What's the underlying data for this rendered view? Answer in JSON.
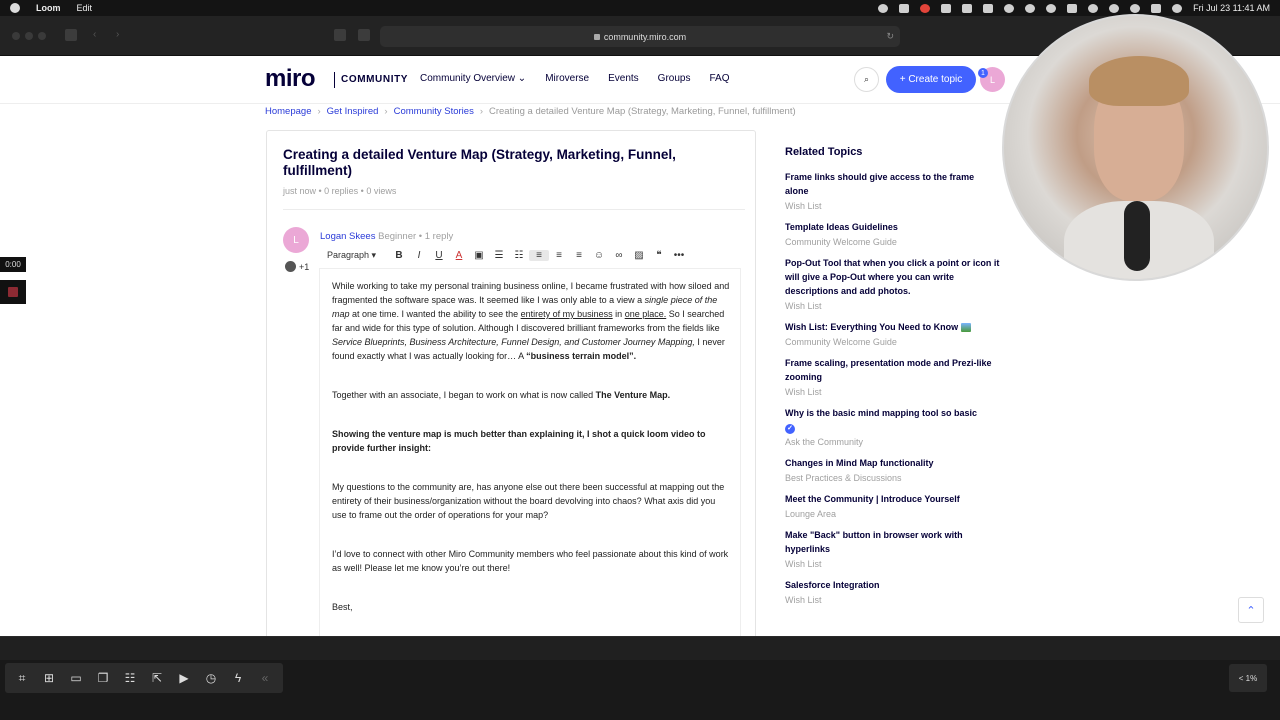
{
  "menubar": {
    "app_name": "Loom",
    "menu_edit": "Edit",
    "datetime": "Fri Jul 23  11:41 AM"
  },
  "browser": {
    "url": "community.miro.com"
  },
  "header": {
    "logo": "miro",
    "logo_suffix": "COMMUNITY",
    "nav": [
      "Community Overview ⌄",
      "Miroverse",
      "Events",
      "Groups",
      "FAQ"
    ],
    "create_topic": "+ Create topic",
    "avatar_initial": "L",
    "notification_count": "1"
  },
  "breadcrumb": {
    "items": [
      "Homepage",
      "Get Inspired",
      "Community Stories"
    ],
    "current": "Creating a detailed Venture Map (Strategy, Marketing, Funnel, fulfillment)",
    "separator": "›"
  },
  "post": {
    "title": "Creating a detailed Venture Map (Strategy, Marketing, Funnel, fulfillment)",
    "meta": "just now  •  0 replies  •  0 views"
  },
  "reply": {
    "avatar_initial": "L",
    "author": "Logan Skees",
    "rank": "Beginner",
    "dot": "•",
    "replies": "1 reply",
    "reaction_count": "+1"
  },
  "toolbar": {
    "paragraph": "Paragraph ▾",
    "bold": "B",
    "italic": "I",
    "underline": "U",
    "font_color": "A",
    "more": "•••"
  },
  "editor": {
    "p1_a": "While working to take my personal training business online, I became frustrated with how siloed and fragmented the software space was. It seemed like I was only able to a view a ",
    "p1_i1": "single piece of the map",
    "p1_b": " at one time. I wanted the ability to see the ",
    "p1_u1": "entirety of my business",
    "p1_c": " in ",
    "p1_u2": "one place.",
    "p1_d": " So I searched far and wide for this type of solution. Although I discovered brilliant frameworks from the fields like ",
    "p1_i2": "Service Blueprints, Business Architecture, Funnel Design, and Customer Journey Mapping,",
    "p1_e": " I never found exactly what I was actually looking for… A ",
    "p1_bold": "“business terrain model”.",
    "p2_a": "Together with an associate, I began to work on what is now called ",
    "p2_bold": "The Venture Map.",
    "p3": "Showing the venture map is much better than explaining it, I shot a quick loom video to provide further insight:",
    "p4": "My questions to the community are, has anyone else out there been successful at mapping out the entirety of their business/organization without the board devolving into chaos? What axis did you use to frame out the order of operations for your map?",
    "p5": "I’d love to connect with other Miro Community members who feel passionate about this kind of work as well! Please let me know you’re out there!",
    "p6": "Best,"
  },
  "related": {
    "title": "Related Topics",
    "topics": [
      {
        "title": "Frame links should give access to the frame alone",
        "category": "Wish List"
      },
      {
        "title": "Template Ideas Guidelines",
        "category": "Community Welcome Guide"
      },
      {
        "title": "Pop-Out Tool that when you click a point or icon it will give a Pop-Out where you can write descriptions and add photos.",
        "category": "Wish List"
      },
      {
        "title": "Wish List: Everything You Need to Know",
        "category": "Community Welcome Guide"
      },
      {
        "title": "Frame scaling, presentation mode and Prezi-like zooming",
        "category": "Wish List"
      },
      {
        "title": "Why is the basic mind mapping tool so basic",
        "category": "Ask the Community"
      },
      {
        "title": "Changes in Mind Map functionality",
        "category": "Best Practices & Discussions"
      },
      {
        "title": "Meet the Community | Introduce Yourself",
        "category": "Lounge Area"
      },
      {
        "title": "Make \"Back\" button in browser work with hyperlinks",
        "category": "Wish List"
      },
      {
        "title": "Salesforce Integration",
        "category": "Wish List"
      }
    ]
  },
  "loom": {
    "timer": "0:00",
    "zoom": "< 1%"
  }
}
